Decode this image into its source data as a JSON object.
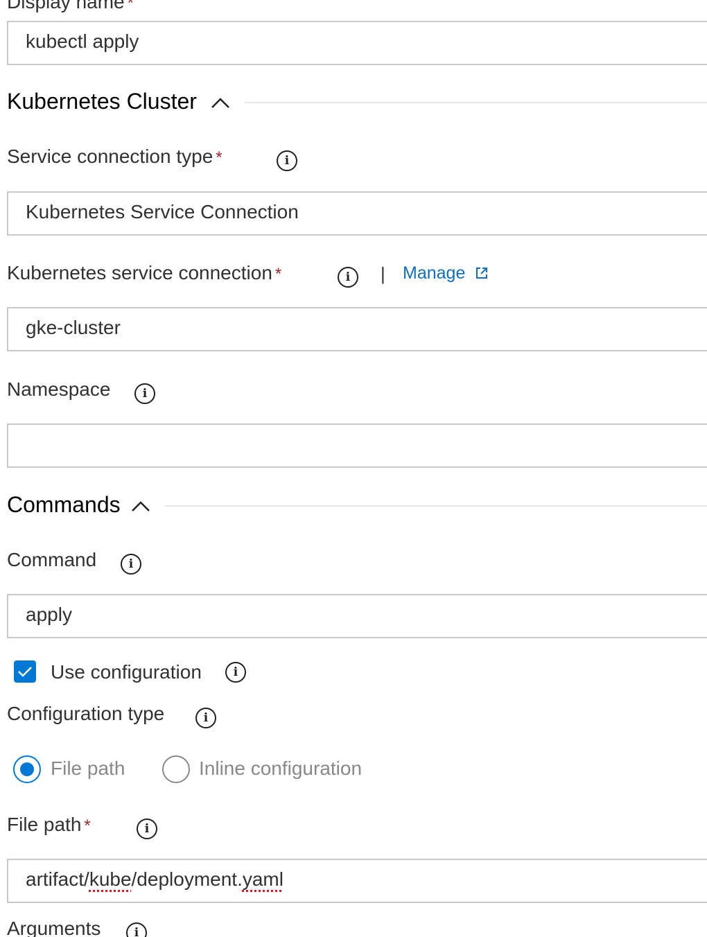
{
  "display_name": {
    "label": "Display name",
    "value": "kubectl apply"
  },
  "kubernetes_cluster_section": {
    "title": "Kubernetes Cluster",
    "service_connection_type": {
      "label": "Service connection type",
      "value": "Kubernetes Service Connection"
    },
    "kubernetes_service_connection": {
      "label": "Kubernetes service connection",
      "separator": "|",
      "manage_link": "Manage",
      "value": "gke-cluster"
    },
    "namespace": {
      "label": "Namespace",
      "value": ""
    }
  },
  "commands_section": {
    "title": "Commands",
    "command": {
      "label": "Command",
      "value": "apply"
    },
    "use_configuration": {
      "label": "Use configuration",
      "checked": true
    },
    "configuration_type": {
      "label": "Configuration type",
      "options": [
        "File path",
        "Inline configuration"
      ],
      "selected": "File path"
    },
    "file_path": {
      "label": "File path",
      "value_parts": [
        "artifact/",
        "kube",
        "/deployment.",
        "yaml"
      ]
    },
    "arguments": {
      "label": "Arguments"
    }
  },
  "required_marker": "*",
  "icons": {
    "info": "info-icon",
    "collapse": "chevron-up-icon",
    "external_link": "external-link-icon",
    "check": "checkmark-icon"
  },
  "colors": {
    "accent": "#0078d4",
    "link": "#106ebe",
    "required": "#a4262c",
    "border": "#c8c8c8"
  }
}
